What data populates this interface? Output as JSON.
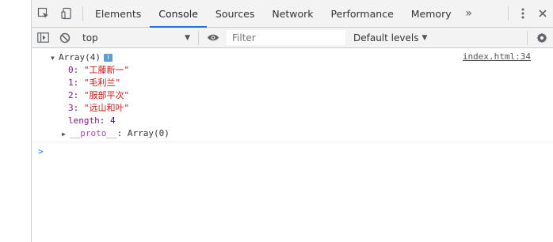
{
  "tabs": [
    "Elements",
    "Console",
    "Sources",
    "Network",
    "Performance",
    "Memory"
  ],
  "active_tab": "Console",
  "more_tabs_glyph": "»",
  "console_toolbar": {
    "context": "top",
    "filter_placeholder": "Filter",
    "levels_label": "Default levels"
  },
  "log": {
    "source": "index.html:34",
    "summary": "Array(4)",
    "items": [
      {
        "index": "0",
        "value": "\"工藤新一\""
      },
      {
        "index": "1",
        "value": "\"毛利兰\""
      },
      {
        "index": "2",
        "value": "\"服部平次\""
      },
      {
        "index": "3",
        "value": "\"远山和叶\""
      }
    ],
    "length_key": "length",
    "length_value": "4",
    "proto_key": "__proto__",
    "proto_value": "Array(0)"
  },
  "prompt_glyph": ">"
}
